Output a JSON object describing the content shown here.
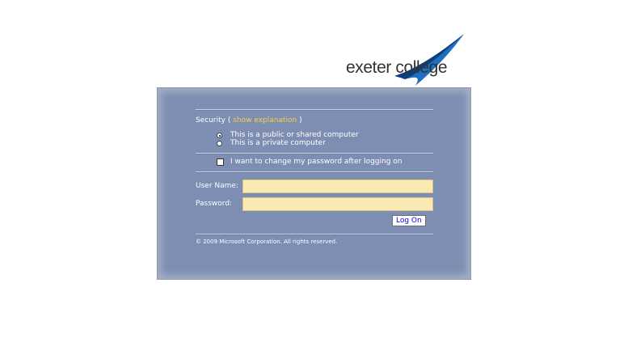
{
  "logo": {
    "text": "exeter college",
    "swoosh_color": "#1f6fbf"
  },
  "security": {
    "label": "Security (",
    "link": "show explanation",
    "close": ")"
  },
  "options": {
    "public": "This is a public or shared computer",
    "private": "This is a private computer",
    "selected": "public"
  },
  "change_password": {
    "label": "I want to change my password after logging on",
    "checked": false
  },
  "form": {
    "username_label": "User Name:",
    "username_value": "",
    "password_label": "Password:",
    "password_value": "",
    "submit_label": "Log On"
  },
  "footer": {
    "copyright": "© 2009 Microsoft Corporation. All rights reserved."
  },
  "colors": {
    "panel": "#7d8eb2",
    "field": "#fbe9b2",
    "link": "#f5d24a"
  }
}
